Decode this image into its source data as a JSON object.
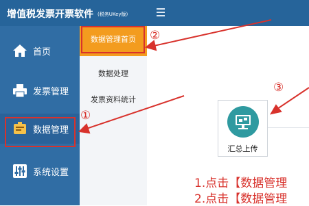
{
  "header": {
    "title": "增值税发票开票软件",
    "subtitle": "(税务UKey版)"
  },
  "sidebar": {
    "items": [
      {
        "label": "首页",
        "icon": "home-icon"
      },
      {
        "label": "发票管理",
        "icon": "printer-icon"
      },
      {
        "label": "数据管理",
        "icon": "data-management-icon",
        "active": true
      },
      {
        "label": "系统设置",
        "icon": "sliders-icon"
      }
    ]
  },
  "submenu": {
    "items": [
      {
        "label": "数据管理首页",
        "active": true
      },
      {
        "label": "数据处理"
      },
      {
        "label": "发票资料统计"
      }
    ]
  },
  "main": {
    "upload_label": "汇总上传",
    "upload_icon": "summary-upload-icon"
  },
  "annotations": {
    "markers": [
      "①",
      "②",
      "③"
    ],
    "steps": [
      "1.点击【数据管理",
      "2.点击【数据管理"
    ]
  },
  "colors": {
    "header": "#26649a",
    "sidebar": "#306da4",
    "active_submenu": "#f39c1f",
    "annotation": "#d8322c",
    "upload_icon_bg": "#2f9aa0"
  }
}
